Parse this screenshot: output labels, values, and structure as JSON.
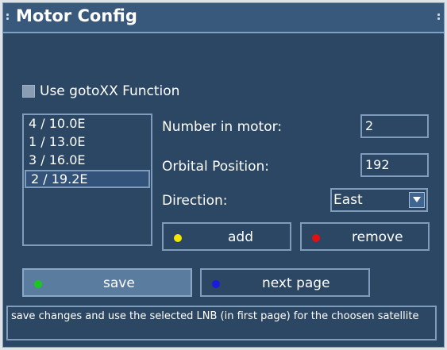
{
  "window": {
    "title": "Motor Config"
  },
  "checkbox": {
    "label": "Use gotoXX Function",
    "checked": false
  },
  "satellites": [
    {
      "label": "4 / 10.0E"
    },
    {
      "label": "1 / 13.0E"
    },
    {
      "label": "3 / 16.0E"
    },
    {
      "label": "2 / 19.2E",
      "selected": true
    }
  ],
  "fields": {
    "number_in_motor": {
      "label": "Number in motor:",
      "value": "2"
    },
    "orbital_position": {
      "label": "Orbital Position:",
      "value": "192"
    },
    "direction": {
      "label": "Direction:",
      "value": "East"
    }
  },
  "buttons": {
    "add": {
      "label": "add",
      "color": "#f3e600"
    },
    "remove": {
      "label": "remove",
      "color": "#e41010"
    },
    "save": {
      "label": "save",
      "color": "#19c81e"
    },
    "next_page": {
      "label": "next page",
      "color": "#1a1ae0"
    }
  },
  "status": "save changes and use the selected LNB (in first page) for the choosen satellite",
  "colors": {
    "background": "#2b4764",
    "border": "#7f9cbc",
    "titlebar": "#38587c",
    "focus": "#5a7c9e"
  }
}
